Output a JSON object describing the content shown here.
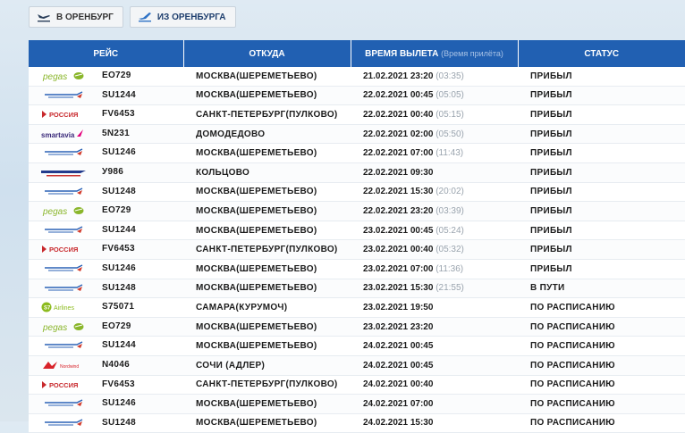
{
  "tabs": {
    "arrival_label": "В ОРЕНБУРГ",
    "departure_label": "ИЗ ОРЕНБУРГА"
  },
  "table": {
    "headers": {
      "flight": "РЕЙС",
      "from": "ОТКУДА",
      "departure_time": "ВРЕМЯ ВЫЛЕТА",
      "arrival_hint": "(Время прилёта)",
      "status": "СТАТУС"
    },
    "rows": [
      {
        "airline": "pegas",
        "code": "EO729",
        "from": "МОСКВА(ШЕРЕМЕТЬЕВО)",
        "dep": "21.02.2021 23:20",
        "arr": "(03:35)",
        "status": "ПРИБЫЛ"
      },
      {
        "airline": "aeroflot",
        "code": "SU1244",
        "from": "МОСКВА(ШЕРЕМЕТЬЕВО)",
        "dep": "22.02.2021 00:45",
        "arr": "(05:05)",
        "status": "ПРИБЫЛ"
      },
      {
        "airline": "rossiya",
        "code": "FV6453",
        "from": "САНКТ-ПЕТЕРБУРГ(ПУЛКОВО)",
        "dep": "22.02.2021 00:40",
        "arr": "(05:15)",
        "status": "ПРИБЫЛ"
      },
      {
        "airline": "smartavia",
        "code": "5N231",
        "from": "ДОМОДЕДОВО",
        "dep": "22.02.2021 02:00",
        "arr": "(05:50)",
        "status": "ПРИБЫЛ"
      },
      {
        "airline": "aeroflot",
        "code": "SU1246",
        "from": "МОСКВА(ШЕРЕМЕТЬЕВО)",
        "dep": "22.02.2021 07:00",
        "arr": "(11:43)",
        "status": "ПРИБЫЛ"
      },
      {
        "airline": "uralairlines",
        "code": "У986",
        "from": "КОЛЬЦОВО",
        "dep": "22.02.2021 09:30",
        "arr": "",
        "status": "ПРИБЫЛ"
      },
      {
        "airline": "aeroflot",
        "code": "SU1248",
        "from": "МОСКВА(ШЕРЕМЕТЬЕВО)",
        "dep": "22.02.2021 15:30",
        "arr": "(20:02)",
        "status": "ПРИБЫЛ"
      },
      {
        "airline": "pegas",
        "code": "EO729",
        "from": "МОСКВА(ШЕРЕМЕТЬЕВО)",
        "dep": "22.02.2021 23:20",
        "arr": "(03:39)",
        "status": "ПРИБЫЛ"
      },
      {
        "airline": "aeroflot",
        "code": "SU1244",
        "from": "МОСКВА(ШЕРЕМЕТЬЕВО)",
        "dep": "23.02.2021 00:45",
        "arr": "(05:24)",
        "status": "ПРИБЫЛ"
      },
      {
        "airline": "rossiya",
        "code": "FV6453",
        "from": "САНКТ-ПЕТЕРБУРГ(ПУЛКОВО)",
        "dep": "23.02.2021 00:40",
        "arr": "(05:32)",
        "status": "ПРИБЫЛ"
      },
      {
        "airline": "aeroflot",
        "code": "SU1246",
        "from": "МОСКВА(ШЕРЕМЕТЬЕВО)",
        "dep": "23.02.2021 07:00",
        "arr": "(11:36)",
        "status": "ПРИБЫЛ"
      },
      {
        "airline": "aeroflot",
        "code": "SU1248",
        "from": "МОСКВА(ШЕРЕМЕТЬЕВО)",
        "dep": "23.02.2021 15:30",
        "arr": "(21:55)",
        "status": "В ПУТИ"
      },
      {
        "airline": "s7",
        "code": "S75071",
        "from": "САМАРА(КУРУМОЧ)",
        "dep": "23.02.2021 19:50",
        "arr": "",
        "status": "ПО РАСПИСАНИЮ"
      },
      {
        "airline": "pegas",
        "code": "EO729",
        "from": "МОСКВА(ШЕРЕМЕТЬЕВО)",
        "dep": "23.02.2021 23:20",
        "arr": "",
        "status": "ПО РАСПИСАНИЮ"
      },
      {
        "airline": "aeroflot",
        "code": "SU1244",
        "from": "МОСКВА(ШЕРЕМЕТЬЕВО)",
        "dep": "24.02.2021 00:45",
        "arr": "",
        "status": "ПО РАСПИСАНИЮ"
      },
      {
        "airline": "nordwind",
        "code": "N4046",
        "from": "СОЧИ (АДЛЕР)",
        "dep": "24.02.2021 00:45",
        "arr": "",
        "status": "ПО РАСПИСАНИЮ"
      },
      {
        "airline": "rossiya",
        "code": "FV6453",
        "from": "САНКТ-ПЕТЕРБУРГ(ПУЛКОВО)",
        "dep": "24.02.2021 00:40",
        "arr": "",
        "status": "ПО РАСПИСАНИЮ"
      },
      {
        "airline": "aeroflot",
        "code": "SU1246",
        "from": "МОСКВА(ШЕРЕМЕТЬЕВО)",
        "dep": "24.02.2021 07:00",
        "arr": "",
        "status": "ПО РАСПИСАНИЮ"
      },
      {
        "airline": "aeroflot",
        "code": "SU1248",
        "from": "МОСКВА(ШЕРЕМЕТЬЕВО)",
        "dep": "24.02.2021 15:30",
        "arr": "",
        "status": "ПО РАСПИСАНИЮ"
      }
    ]
  },
  "logos": {
    "pegas": {
      "text": "pegas",
      "color": "#8ab62b",
      "icon": "pegas-fly-logo-icon"
    },
    "aeroflot": {
      "text": "",
      "color": "#2b62b6",
      "icon": "aeroflot-logo-icon"
    },
    "rossiya": {
      "text": "РОССИЯ",
      "color": "#c8282c",
      "icon": "rossiya-logo-icon"
    },
    "smartavia": {
      "text": "smartavia",
      "color": "#3a2a7a",
      "icon": "smartavia-logo-icon"
    },
    "uralairlines": {
      "text": "",
      "color": "#223a8c",
      "icon": "ural-airlines-logo-icon"
    },
    "s7": {
      "text": "Airlines",
      "color": "#8cbb1e",
      "icon": "s7-airlines-logo-icon"
    },
    "nordwind": {
      "text": "Nordwind",
      "color": "#d8232a",
      "icon": "nordwind-logo-icon"
    }
  },
  "colors": {
    "header_bg": "#2160b2",
    "tab_text": "#1f3f6e",
    "arrival_time_text": "#9aa4ae"
  }
}
